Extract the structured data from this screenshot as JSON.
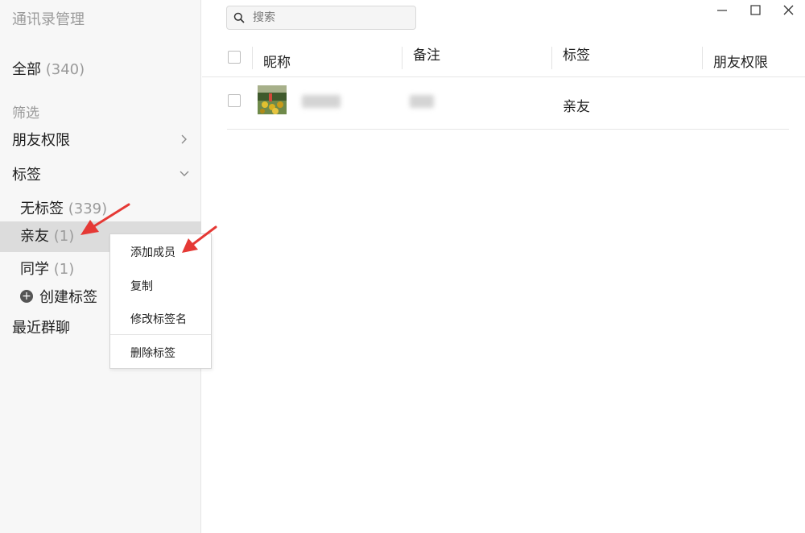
{
  "sidebar": {
    "title": "通讯录管理",
    "all_label": "全部",
    "all_count": "(340)",
    "filter_label": "筛选",
    "friend_permission": "朋友权限",
    "tags_label": "标签",
    "tags": [
      {
        "label": "无标签",
        "count": "(339)"
      },
      {
        "label": "亲友",
        "count": "(1)"
      },
      {
        "label": "同学",
        "count": "(1)"
      }
    ],
    "create_tag": "创建标签",
    "recent_groups": "最近群聊"
  },
  "search": {
    "placeholder": "搜索"
  },
  "table": {
    "columns": [
      "昵称",
      "备注",
      "标签",
      "朋友权限"
    ],
    "rows": [
      {
        "tag": "亲友"
      }
    ]
  },
  "context_menu": {
    "items": [
      "添加成员",
      "复制",
      "修改标签名",
      "删除标签"
    ]
  },
  "colors": {
    "selected_bg": "#dcdcdc",
    "sidebar_bg": "#f7f7f7",
    "annotation_arrow": "#e53935"
  }
}
